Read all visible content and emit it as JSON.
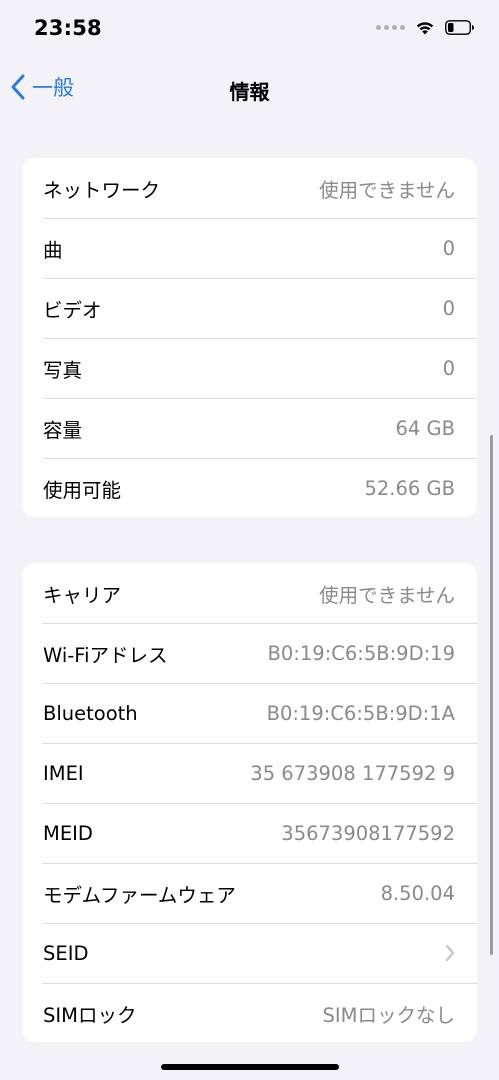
{
  "status_bar": {
    "time": "23:58",
    "icons": [
      "signal-dots-icon",
      "wifi-icon",
      "battery-icon"
    ]
  },
  "nav": {
    "back_label": "一般",
    "title": "情報",
    "back_icon": "chevron-left-icon"
  },
  "scrolled_link": {
    "text": ""
  },
  "group1": {
    "rows": [
      {
        "label": "ネットワーク",
        "value": "使用できません"
      },
      {
        "label": "曲",
        "value": "0"
      },
      {
        "label": "ビデオ",
        "value": "0"
      },
      {
        "label": "写真",
        "value": "0"
      },
      {
        "label": "容量",
        "value": "64 GB"
      },
      {
        "label": "使用可能",
        "value": "52.66 GB"
      }
    ]
  },
  "group2": {
    "rows": [
      {
        "label": "キャリア",
        "value": "使用できません"
      },
      {
        "label": "Wi-Fiアドレス",
        "value": "B0:19:C6:5B:9D:19"
      },
      {
        "label": "Bluetooth",
        "value": "B0:19:C6:5B:9D:1A"
      },
      {
        "label": "IMEI",
        "value": "35 673908 177592 9"
      },
      {
        "label": "MEID",
        "value": "35673908177592"
      },
      {
        "label": "モデムファームウェア",
        "value": "8.50.04"
      },
      {
        "label": "SEID",
        "value": ""
      },
      {
        "label": "SIMロック",
        "value": "SIMロックなし"
      }
    ]
  },
  "colors": {
    "background": "#f2f2f7",
    "accent": "#2a7be0",
    "secondary_text": "#8a8a8e"
  }
}
